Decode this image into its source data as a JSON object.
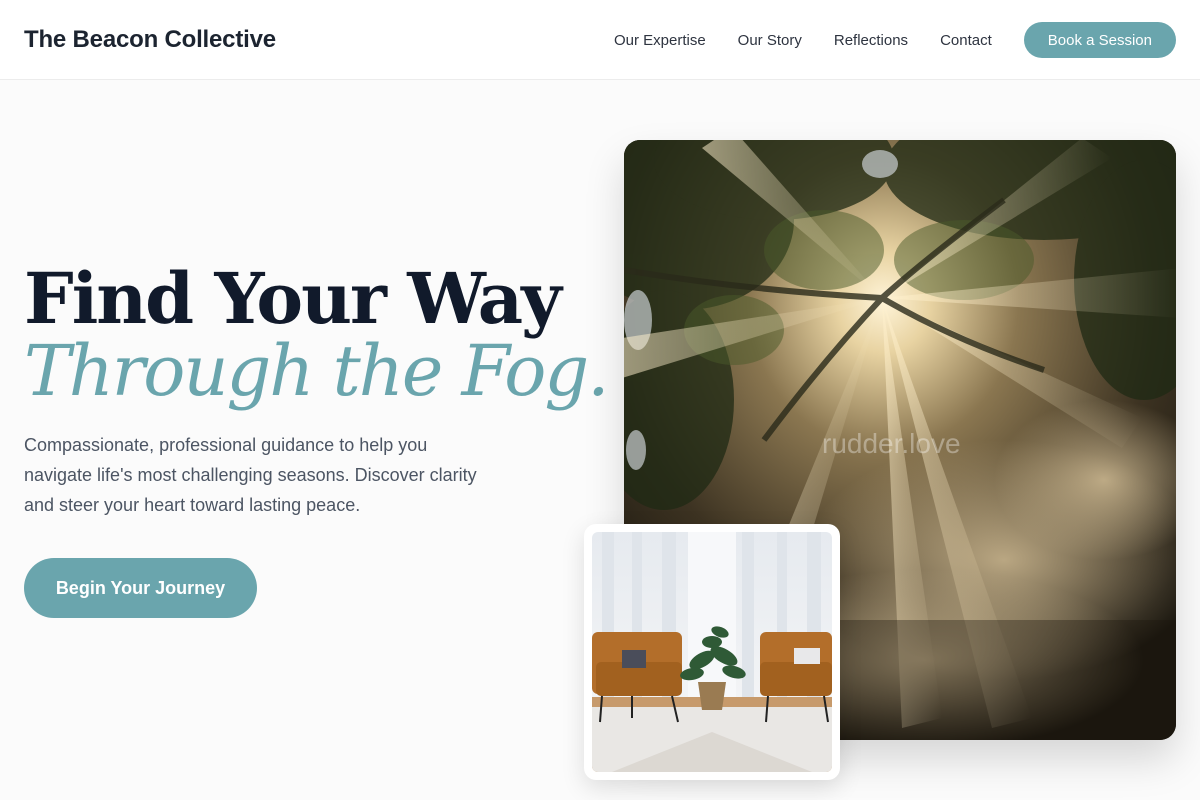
{
  "header": {
    "brand": "The Beacon Collective",
    "nav": [
      {
        "label": "Our Expertise"
      },
      {
        "label": "Our Story"
      },
      {
        "label": "Reflections"
      },
      {
        "label": "Contact"
      }
    ],
    "cta_label": "Book a Session"
  },
  "hero": {
    "title_line1": "Find Your Way",
    "title_line2": "Through the Fog.",
    "description": "Compassionate, professional guidance to help you navigate life's most challenging seasons. Discover clarity and steer your heart toward lasting peace.",
    "cta_label": "Begin Your Journey"
  },
  "images": {
    "watermark": "rudder.love"
  },
  "colors": {
    "accent": "#6aa5ad",
    "heading": "#111a2b",
    "body_text": "#4c5563"
  }
}
